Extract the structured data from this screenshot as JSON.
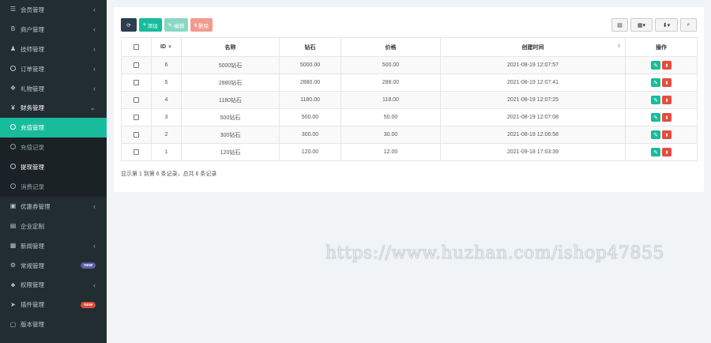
{
  "sidebar": {
    "items": [
      {
        "label": "会员管理",
        "icon": "list-icon",
        "glyph": "☰",
        "state": "normal",
        "chevron": "‹"
      },
      {
        "label": "商户管理",
        "icon": "bold-b-icon",
        "glyph": "B",
        "state": "normal",
        "chevron": "‹"
      },
      {
        "label": "技师管理",
        "icon": "user-icon",
        "glyph": "♟",
        "state": "normal",
        "chevron": "‹"
      },
      {
        "label": "订单管理",
        "icon": "circle-icon",
        "glyph": "ring",
        "state": "normal",
        "chevron": "‹"
      },
      {
        "label": "礼物管理",
        "icon": "gift-icon",
        "glyph": "❖",
        "state": "normal",
        "chevron": "‹"
      },
      {
        "label": "财务管理",
        "icon": "yen-icon",
        "glyph": "¥",
        "state": "open",
        "chevron": "⌄"
      },
      {
        "label": "充值管理",
        "icon": "circle-icon",
        "glyph": "ring",
        "state": "active",
        "chevron": ""
      },
      {
        "label": "充值记录",
        "icon": "circle-icon",
        "glyph": "ring",
        "state": "sub-dim",
        "chevron": ""
      },
      {
        "label": "提现管理",
        "icon": "circle-icon",
        "glyph": "ring",
        "state": "sub-bright",
        "chevron": ""
      },
      {
        "label": "消费记录",
        "icon": "circle-icon",
        "glyph": "ring",
        "state": "sub-dim",
        "chevron": ""
      },
      {
        "label": "优惠券管理",
        "icon": "ticket-icon",
        "glyph": "▣",
        "state": "normal",
        "chevron": "‹"
      },
      {
        "label": "企业定制",
        "icon": "document-icon",
        "glyph": "▤",
        "state": "normal",
        "chevron": ""
      },
      {
        "label": "新闻管理",
        "icon": "calendar-icon",
        "glyph": "▦",
        "state": "normal",
        "chevron": "‹"
      },
      {
        "label": "常规管理",
        "icon": "gears-icon",
        "glyph": "⚙",
        "state": "normal",
        "chevron": "",
        "badge": "new",
        "badge_color": "#605ca8"
      },
      {
        "label": "权限管理",
        "icon": "group-icon",
        "glyph": "♣",
        "state": "normal",
        "chevron": "‹"
      },
      {
        "label": "插件管理",
        "icon": "rocket-icon",
        "glyph": "➤",
        "state": "normal",
        "chevron": "",
        "badge": "new",
        "badge_color": "#dd4b39"
      },
      {
        "label": "版本管理",
        "icon": "file-icon",
        "glyph": "▢",
        "state": "normal",
        "chevron": ""
      }
    ]
  },
  "toolbar": {
    "refresh_glyph": "⟳",
    "add_label": "添加",
    "add_glyph": "+",
    "edit_label": "编辑",
    "edit_glyph": "✎",
    "delete_label": "删除",
    "delete_glyph": "▮",
    "right_tools": [
      {
        "name": "toggle-view-button",
        "icon": "table-icon",
        "glyph": "▤"
      },
      {
        "name": "columns-dropdown-button",
        "icon": "grid-icon",
        "glyph": "▦▾"
      },
      {
        "name": "export-dropdown-button",
        "icon": "user-export-icon",
        "glyph": "⬇▾"
      },
      {
        "name": "search-toggle-button",
        "icon": "search-icon",
        "glyph": "⌕"
      }
    ]
  },
  "table": {
    "columns": [
      "ID",
      "名称",
      "钻石",
      "价格",
      "创建时间",
      "操作"
    ],
    "rows": [
      {
        "id": "6",
        "name": "5000钻石",
        "diamond": "5000.00",
        "price": "500.00",
        "created": "2021-08-19 12:07:57"
      },
      {
        "id": "5",
        "name": "2880钻石",
        "diamond": "2880.00",
        "price": "288.00",
        "created": "2021-08-19 12:07:41"
      },
      {
        "id": "4",
        "name": "1180钻石",
        "diamond": "1180.00",
        "price": "118.00",
        "created": "2021-08-19 12:07:25"
      },
      {
        "id": "3",
        "name": "500钻石",
        "diamond": "500.00",
        "price": "50.00",
        "created": "2021-08-19 12:07:08"
      },
      {
        "id": "2",
        "name": "300钻石",
        "diamond": "300.00",
        "price": "30.00",
        "created": "2021-08-19 12:06:58"
      },
      {
        "id": "1",
        "name": "120钻石",
        "diamond": "120.00",
        "price": "12.00",
        "created": "2021-09-18 17:03:39"
      }
    ],
    "edit_glyph": "✎",
    "delete_glyph": "▮",
    "sort_desc_glyph": "▼",
    "sort_both_glyph": "⇕"
  },
  "pagination_text": "显示第 1 到第 6 条记录，总共 6 条记录",
  "watermark": "https://www.huzhan.com/ishop47855",
  "colors": {
    "sidebar_bg": "#222d32",
    "accent": "#18bc9c",
    "danger": "#e74c3c",
    "primary_dark": "#2c3e50"
  }
}
